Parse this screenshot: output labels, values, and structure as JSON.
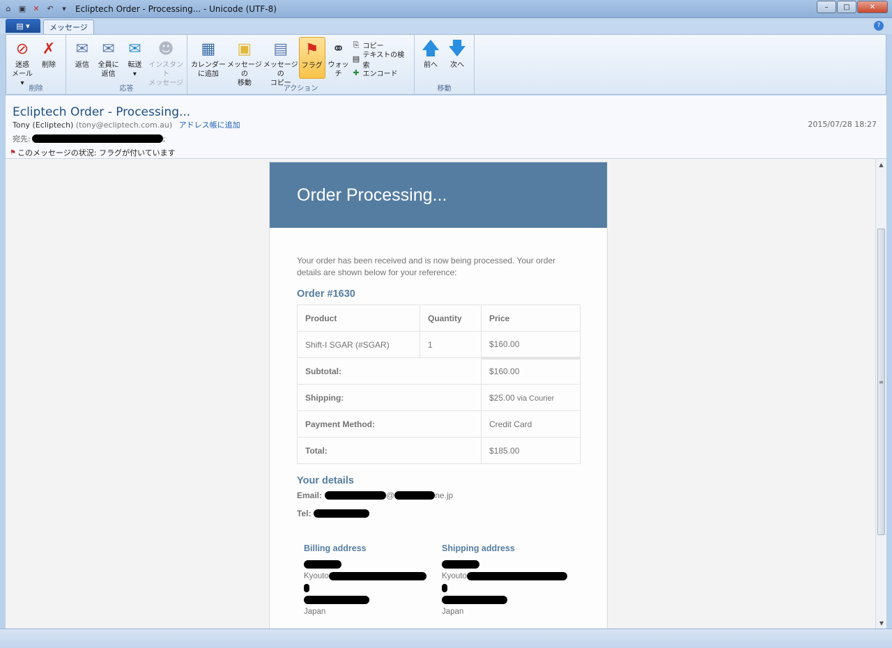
{
  "window": {
    "title": "Ecliptech Order - Processing... - Unicode (UTF-8)",
    "minimize": "0",
    "maximize": "1",
    "close": "r"
  },
  "tabs": {
    "app_menu": "▤ ▾",
    "active_tab": "メッセージ"
  },
  "ribbon": {
    "delete_group": {
      "label": "削除",
      "junk": "迷惑\nメール ▾",
      "delete": "削除"
    },
    "respond_group": {
      "label": "応答",
      "reply": "返信",
      "reply_all": "全員に\n返信",
      "forward": "転送\n▾",
      "im": "インスタント\nメッセージ"
    },
    "actions_group": {
      "label": "アクション",
      "calendar": "カレンダー\nに追加",
      "move": "メッセージの\n移動",
      "copy_msg": "メッセージの\nコピー",
      "flag": "フラグ",
      "watch": "ウォッチ",
      "copy": "コピー",
      "find_text": "テキストの検索",
      "encode": "エンコード"
    },
    "move_group": {
      "label": "移動",
      "prev": "前へ",
      "next": "次へ"
    }
  },
  "message": {
    "subject": "Ecliptech Order - Processing...",
    "from_name": "Tony (Ecliptech)",
    "from_addr": "(tony@ecliptech.com.au)",
    "add_contact": "アドレス帳に追加",
    "date": "2015/07/28 18:27",
    "to_label": "宛先:",
    "to_suffix": ";",
    "status": "このメッセージの状況: フラグが付いています"
  },
  "email": {
    "banner_title": "Order Processing...",
    "intro": "Your order has been received and is now being processed. Your order details are shown below for your reference:",
    "order_heading": "Order #1630",
    "table": {
      "headers": [
        "Product",
        "Quantity",
        "Price"
      ],
      "item": {
        "product": "Shift-I SGAR (#SGAR)",
        "quantity": "1",
        "price": "$160.00"
      },
      "subtotal_label": "Subtotal:",
      "subtotal": "$160.00",
      "shipping_label": "Shipping:",
      "shipping": "$25.00",
      "shipping_via": "via Courier",
      "payment_label": "Payment Method:",
      "payment": "Credit Card",
      "total_label": "Total:",
      "total": "$185.00"
    },
    "details_heading": "Your details",
    "email_label": "Email:",
    "email_at": "@",
    "email_domain": "ne.jp",
    "tel_label": "Tel:",
    "billing_heading": "Billing address",
    "shipping_heading": "Shipping address",
    "city": "Kyouto",
    "country": "Japan"
  }
}
